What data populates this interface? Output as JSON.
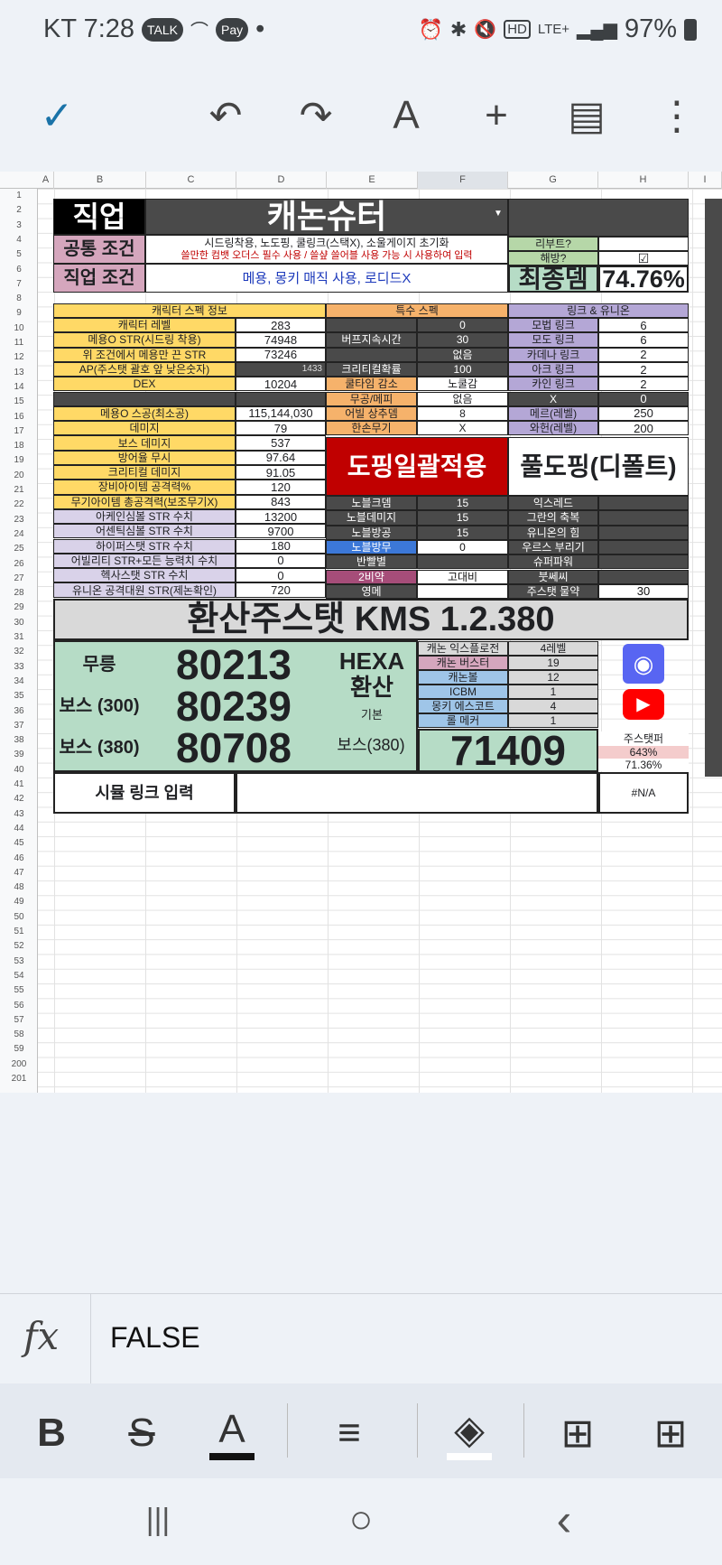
{
  "status_bar": {
    "carrier_time": "KT 7:28",
    "talk": "TALK",
    "pay": "Pay",
    "dot": "•",
    "net": "LTE+",
    "battery": "97%"
  },
  "toolbar": {
    "check": "✓",
    "undo": "↶",
    "redo": "↷",
    "textfmt": "A",
    "add": "+",
    "comment": "▤",
    "more": "⋮"
  },
  "columns": [
    "A",
    "B",
    "C",
    "D",
    "E",
    "F",
    "G",
    "H",
    "I"
  ],
  "rows": [
    "1",
    "2",
    "3",
    "4",
    "5",
    "6",
    "7",
    "8",
    "9",
    "10",
    "11",
    "12",
    "13",
    "14",
    "15",
    "16",
    "17",
    "18",
    "19",
    "20",
    "21",
    "22",
    "23",
    "24",
    "25",
    "26",
    "27",
    "28",
    "29",
    "30",
    "31",
    "32",
    "33",
    "34",
    "35",
    "36",
    "37",
    "38",
    "39",
    "40",
    "41",
    "42",
    "43",
    "44",
    "45",
    "46",
    "47",
    "48",
    "49",
    "50",
    "51",
    "52",
    "53",
    "54",
    "55",
    "56",
    "57",
    "58",
    "59",
    "200",
    "201"
  ],
  "header": {
    "job_label": "직업",
    "job_value": "캐논슈터",
    "common_label": "공통 조건",
    "common_line1": "시드링착용, 노도핑, 쿨링크(스택X), 소울게이지 초기화",
    "common_line2": "쓸만한 컴뱃 오더스 필수 사용 / 쓸샾 쓸어블 사용 가능 시 사용하여 입력",
    "job_cond_label": "직업 조건",
    "job_cond_value": "메용, 몽키 매직 사용, 로디드X",
    "reboot_label": "리부트?",
    "unlock_label": "해방?",
    "final_label": "최종뎀",
    "final_value": "74.76%"
  },
  "sections": {
    "char_spec": "캐릭터 스펙 정보",
    "special_spec": "특수 스펙",
    "link_union": "링크 & 유니온"
  },
  "char_stats": [
    {
      "label": "캐릭터 레벨",
      "value": "283"
    },
    {
      "label": "메용O STR(시드링 착용)",
      "value": "74948"
    },
    {
      "label": "위 조건에서 메용만 끈 STR",
      "value": "73246"
    },
    {
      "label": "AP(주스탯 괄호 앞 낮은숫자)",
      "value": "1433"
    },
    {
      "label": "DEX",
      "value": "10204"
    },
    {
      "label": "",
      "value": ""
    },
    {
      "label": "메용O 스공(최소공)",
      "value": "115,144,030"
    },
    {
      "label": "데미지",
      "value": "79"
    },
    {
      "label": "보스 데미지",
      "value": "537"
    },
    {
      "label": "방어율 무시",
      "value": "97.64"
    },
    {
      "label": "크리티컬 데미지",
      "value": "91.05"
    },
    {
      "label": "장비아이템 공격력%",
      "value": "120"
    },
    {
      "label": "무기아이템 총공격력(보조무기X)",
      "value": "843"
    },
    {
      "label": "아케인심볼 STR 수치",
      "value": "13200"
    },
    {
      "label": "어센틱심볼 STR 수치",
      "value": "9700"
    },
    {
      "label": "하이퍼스탯 STR 수치",
      "value": "180"
    },
    {
      "label": "어빌리티 STR+모든 능력치 수치",
      "value": "0"
    },
    {
      "label": "헥사스탯 STR 수치",
      "value": "0"
    },
    {
      "label": "유니온 공격대원 STR(제논확인)",
      "value": "720"
    }
  ],
  "special": [
    {
      "label": "",
      "value": "0"
    },
    {
      "label": "버프지속시간",
      "value": "30"
    },
    {
      "label": "",
      "value": "없음"
    },
    {
      "label": "크리티컬확률",
      "value": "100"
    },
    {
      "label": "쿨타임 감소",
      "value": "노쿨감"
    },
    {
      "label": "무공/메피",
      "value": "없음"
    },
    {
      "label": "어빌 상추뎀",
      "value": "8"
    },
    {
      "label": "한손무기",
      "value": "X"
    }
  ],
  "links": [
    {
      "label": "모법 링크",
      "value": "6"
    },
    {
      "label": "모도 링크",
      "value": "6"
    },
    {
      "label": "카데나 링크",
      "value": "2"
    },
    {
      "label": "아크 링크",
      "value": "2"
    },
    {
      "label": "카인 링크",
      "value": "2"
    },
    {
      "label": "X",
      "value": "0"
    },
    {
      "label": "메르(레벨)",
      "value": "250"
    },
    {
      "label": "와헌(레벨)",
      "value": "200"
    }
  ],
  "doping": {
    "apply_all": "도핑일괄적용",
    "full": "풀도핑(디폴트)"
  },
  "buffs": [
    {
      "label": "노블크뎀",
      "value": "15"
    },
    {
      "label": "노블데미지",
      "value": "15"
    },
    {
      "label": "노블방공",
      "value": "15"
    },
    {
      "label": "노블방무",
      "value": "0"
    },
    {
      "label": "반빨별",
      "value": ""
    },
    {
      "label": "2비약",
      "value": "고대비"
    },
    {
      "label": "영메",
      "value": ""
    }
  ],
  "extras": [
    {
      "label": "익스레드",
      "value": ""
    },
    {
      "label": "그란의 축복",
      "value": ""
    },
    {
      "label": "유니온의 힘",
      "value": ""
    },
    {
      "label": "우르스 부리기",
      "value": ""
    },
    {
      "label": "슈퍼파워",
      "value": ""
    },
    {
      "label": "붓쎄씨",
      "value": ""
    },
    {
      "label": "주스탯 물약",
      "value": "30"
    }
  ],
  "conversion": {
    "title": "환산주스탯 KMS 1.2.380",
    "rows": [
      {
        "label": "무릉",
        "value": "80213"
      },
      {
        "label": "보스 (300)",
        "value": "80239"
      },
      {
        "label": "보스 (380)",
        "value": "80708"
      }
    ],
    "hexa_label": "HEXA 환산",
    "base_label": "기본",
    "boss_label": "보스(380)",
    "hexa_value": "71409"
  },
  "hexa_skills": [
    {
      "label": "캐논 익스플로전",
      "value": "4레벨"
    },
    {
      "label": "캐논 버스터",
      "value": "19"
    },
    {
      "label": "캐논볼",
      "value": "12"
    },
    {
      "label": "ICBM",
      "value": "1"
    },
    {
      "label": "몽키 에스코트",
      "value": "4"
    },
    {
      "label": "롤 메커",
      "value": "1"
    }
  ],
  "mainstat": {
    "label": "주스탯퍼",
    "v1": "643%",
    "v2": "71.36%"
  },
  "link_row": {
    "label": "시뮬 링크 입력",
    "value": "",
    "na": "#N/A"
  },
  "formula": {
    "fx": "fx",
    "value": "FALSE"
  },
  "format_bar": {
    "bold": "B",
    "strike": "S",
    "textcolor": "A",
    "align": "≡",
    "fill": "◈",
    "insrow": "⊞",
    "inscol": "⊞"
  },
  "nav": {
    "recent": "|||",
    "home": "○",
    "back": "‹"
  },
  "colors": {
    "black": "#1a1a1a",
    "dark": "#4a4a4a",
    "yellow": "#ffd966",
    "pink": "#d5a6bd",
    "red": "#c00000",
    "green": "#b6dcc6",
    "purple": "#b4a7d6",
    "orange": "#f6b26b",
    "blue": "#9fc5e8",
    "grey": "#d9d9d9"
  }
}
